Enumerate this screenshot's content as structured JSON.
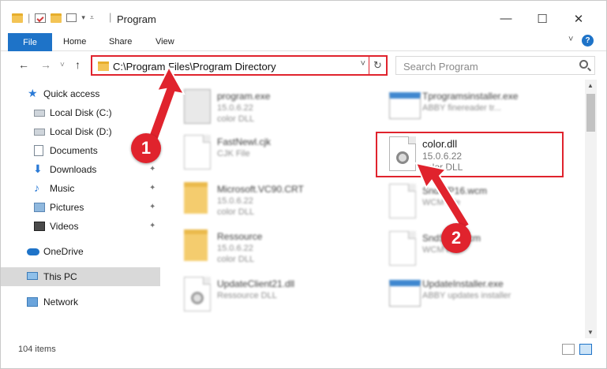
{
  "window": {
    "title": "Program",
    "minimize": "—",
    "maximize": "☐",
    "close": "✕"
  },
  "ribbon": {
    "tabs": [
      "File",
      "Home",
      "Share",
      "View"
    ],
    "collapse": "˅",
    "help": "?"
  },
  "address": {
    "path": "C:\\Program Files\\Program Directory",
    "dropdown": "˅",
    "refresh": "↻"
  },
  "search": {
    "placeholder": "Search Program"
  },
  "nav": {
    "back": "←",
    "forward": "→",
    "recent": "˅",
    "up": "↑"
  },
  "sidebar": {
    "items": [
      {
        "label": "Quick access",
        "icon": "star-icon"
      },
      {
        "label": "Local Disk (C:)",
        "icon": "disk-icon"
      },
      {
        "label": "Local Disk (D:)",
        "icon": "disk-icon"
      },
      {
        "label": "Documents",
        "icon": "documents-icon"
      },
      {
        "label": "Downloads",
        "icon": "download-icon",
        "pinned": true
      },
      {
        "label": "Music",
        "icon": "music-icon",
        "pinned": true
      },
      {
        "label": "Pictures",
        "icon": "pictures-icon",
        "pinned": true
      },
      {
        "label": "Videos",
        "icon": "videos-icon",
        "pinned": true
      },
      {
        "label": "OneDrive",
        "icon": "onedrive-icon"
      },
      {
        "label": "This PC",
        "icon": "pc-icon",
        "selected": true
      },
      {
        "label": "Network",
        "icon": "network-icon"
      }
    ],
    "pin_glyph": "📌"
  },
  "files": [
    {
      "name": "program.exe",
      "line1": "15.0.6.22",
      "line2": "color DLL",
      "icon": "exe"
    },
    {
      "name": "Tprogramsinstaller.exe",
      "line1": "ABBY finereader tr...",
      "line2": "",
      "icon": "win"
    },
    {
      "name": "FastNewl.cjk",
      "line1": "CJK File",
      "line2": "",
      "icon": "doc"
    },
    {
      "name": "color.dll",
      "line1": "15.0.6.22",
      "line2": "color DLL",
      "icon": "dll"
    },
    {
      "name": "Microsoft.VC90.CRT",
      "line1": "15.0.6.22",
      "line2": "color DLL",
      "icon": "folder"
    },
    {
      "name": "SndWP16.wcm",
      "line1": "WCM File",
      "line2": "",
      "icon": "doc"
    },
    {
      "name": "Ressource",
      "line1": "15.0.6.22",
      "line2": "color DLL",
      "icon": "folder"
    },
    {
      "name": "SndSEN.wcm",
      "line1": "WCM File",
      "line2": "",
      "icon": "doc"
    },
    {
      "name": "UpdateClient21.dll",
      "line1": "Ressource DLL",
      "line2": "",
      "icon": "dll"
    },
    {
      "name": "UpdateInstaller.exe",
      "line1": "ABBY updates installer",
      "line2": "",
      "icon": "win"
    }
  ],
  "status": {
    "count": "104 items"
  },
  "annotations": {
    "step1": "1",
    "step2": "2",
    "color": "#e0232d"
  },
  "colors": {
    "accent": "#1e73c8",
    "highlight": "#e0232d",
    "folder": "#f3c455"
  }
}
